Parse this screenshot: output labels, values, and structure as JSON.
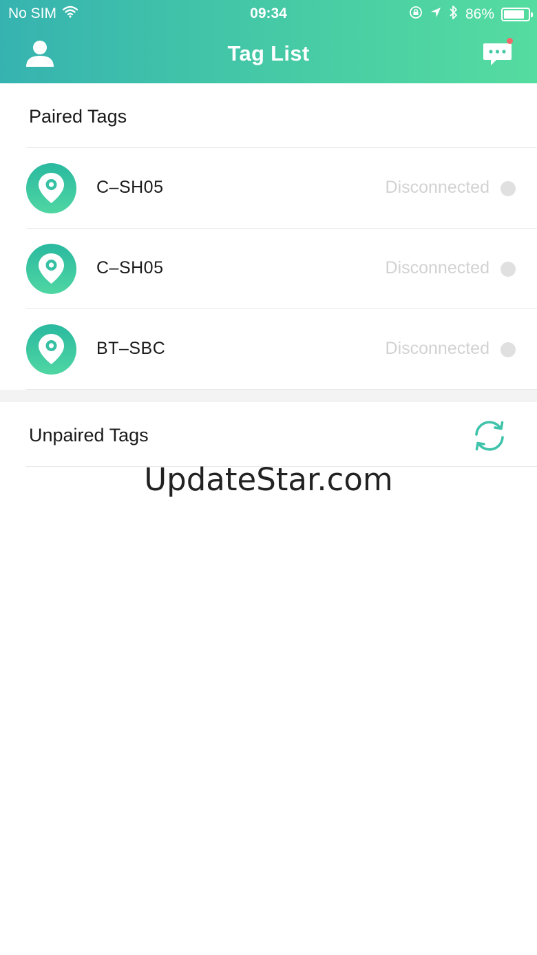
{
  "status_bar": {
    "carrier": "No SIM",
    "time": "09:34",
    "battery": "86%",
    "battery_level": 0.86
  },
  "header": {
    "title": "Tag List",
    "profile_icon": "user-icon",
    "message_icon": "chat-bubble-icon",
    "has_notification": true
  },
  "paired": {
    "title": "Paired Tags",
    "tags": [
      {
        "name": "C–SH05",
        "status": "Disconnected"
      },
      {
        "name": "C–SH05",
        "status": "Disconnected"
      },
      {
        "name": "BT–SBC",
        "status": "Disconnected"
      }
    ]
  },
  "unpaired": {
    "title": "Unpaired Tags",
    "refresh_icon": "refresh-icon"
  },
  "watermark": "UpdateStar.com",
  "colors": {
    "brand_start": "#36b3b0",
    "brand_end": "#55dca0",
    "status_disconnected": "#d2d2d2",
    "notification": "#f06a6a"
  }
}
